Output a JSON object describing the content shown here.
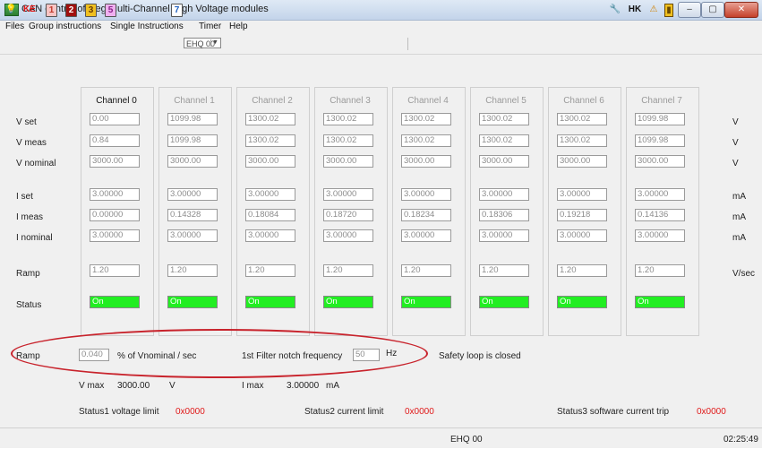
{
  "window": {
    "title": "CAN control of iseg Multi-Channel High Voltage modules",
    "controls": {
      "minimize": "–",
      "maximize": "▢",
      "close": "✕"
    }
  },
  "menu": [
    "Files",
    "Group instructions",
    "Single Instructions",
    "Timer",
    "Help"
  ],
  "toolbar": {
    "left": [
      {
        "icon": "lightbulb-icon",
        "glyph": "💡",
        "color": "#d4a017"
      },
      {
        "icon": "ke-icon",
        "label": "KE",
        "color": "#e01a1a"
      },
      {
        "icon": "digit-1-icon",
        "label": "1",
        "color": "#e05050"
      },
      {
        "icon": "digit-2-icon",
        "label": "2",
        "color": "#c0392b"
      },
      {
        "icon": "digit-3-icon",
        "label": "3",
        "color": "#f0c020"
      },
      {
        "icon": "digit-5-icon",
        "label": "5",
        "color": "#c040c0"
      },
      {
        "icon": "digit-7-icon",
        "label": "7",
        "color": "#2060c0"
      }
    ],
    "module_select": "EHQ 00",
    "right": [
      {
        "icon": "tools-icon",
        "glyph": "🔧"
      },
      {
        "icon": "hk-icon",
        "label": "HK"
      },
      {
        "icon": "warning-icon",
        "glyph": "⚠"
      },
      {
        "icon": "exit-door-icon",
        "glyph": "▮"
      }
    ]
  },
  "channels": [
    {
      "name": "Channel 0",
      "vset": "0.00",
      "vmeas": "0.84",
      "vnominal": "3000.00",
      "iset": "3.00000",
      "imeas": "0.00000",
      "inominal": "3.00000",
      "ramp": "1.20",
      "status": "On"
    },
    {
      "name": "Channel 1",
      "vset": "1099.98",
      "vmeas": "1099.98",
      "vnominal": "3000.00",
      "iset": "3.00000",
      "imeas": "0.14328",
      "inominal": "3.00000",
      "ramp": "1.20",
      "status": "On"
    },
    {
      "name": "Channel 2",
      "vset": "1300.02",
      "vmeas": "1300.02",
      "vnominal": "3000.00",
      "iset": "3.00000",
      "imeas": "0.18084",
      "inominal": "3.00000",
      "ramp": "1.20",
      "status": "On"
    },
    {
      "name": "Channel 3",
      "vset": "1300.02",
      "vmeas": "1300.02",
      "vnominal": "3000.00",
      "iset": "3.00000",
      "imeas": "0.18720",
      "inominal": "3.00000",
      "ramp": "1.20",
      "status": "On"
    },
    {
      "name": "Channel 4",
      "vset": "1300.02",
      "vmeas": "1300.02",
      "vnominal": "3000.00",
      "iset": "3.00000",
      "imeas": "0.18234",
      "inominal": "3.00000",
      "ramp": "1.20",
      "status": "On"
    },
    {
      "name": "Channel 5",
      "vset": "1300.02",
      "vmeas": "1300.02",
      "vnominal": "3000.00",
      "iset": "3.00000",
      "imeas": "0.18306",
      "inominal": "3.00000",
      "ramp": "1.20",
      "status": "On"
    },
    {
      "name": "Channel 6",
      "vset": "1300.02",
      "vmeas": "1300.02",
      "vnominal": "3000.00",
      "iset": "3.00000",
      "imeas": "0.19218",
      "inominal": "3.00000",
      "ramp": "1.20",
      "status": "On"
    },
    {
      "name": "Channel 7",
      "vset": "1099.98",
      "vmeas": "1099.98",
      "vnominal": "3000.00",
      "iset": "3.00000",
      "imeas": "0.14136",
      "inominal": "3.00000",
      "ramp": "1.20",
      "status": "On"
    }
  ],
  "row_labels": {
    "vset": "V set",
    "vmeas": "V meas",
    "vnominal": "V nominal",
    "iset": "I set",
    "imeas": "I meas",
    "inominal": "I nominal",
    "ramp": "Ramp",
    "status": "Status"
  },
  "units": {
    "vset": "V",
    "vmeas": "V",
    "vnominal": "V",
    "iset": "mA",
    "imeas": "mA",
    "inominal": "mA",
    "ramp": "V/sec"
  },
  "module": {
    "ramp_label": "Ramp",
    "ramp_value": "0.040",
    "ramp_unit": "% of Vnominal / sec",
    "filter_label": "1st Filter notch frequency",
    "filter_value": "50",
    "filter_unit": "Hz",
    "safety_loop": "Safety loop is closed",
    "vmax_label": "V max",
    "vmax_value": "3000.00",
    "vmax_unit": "V",
    "imax_label": "I max",
    "imax_value": "3.00000",
    "imax_unit": "mA",
    "status1_label": "Status1 voltage limit",
    "status1_value": "0x0000",
    "status2_label": "Status2 current limit",
    "status2_value": "0x0000",
    "status3_label": "Status3 software current trip",
    "status3_value": "0x0000"
  },
  "statusbar": {
    "module": "EHQ 00",
    "time": "02:25:49"
  },
  "colors": {
    "status_on": "#22ee22",
    "status_hex": "#e01a1a",
    "annotation_oval": "#c8232c"
  }
}
